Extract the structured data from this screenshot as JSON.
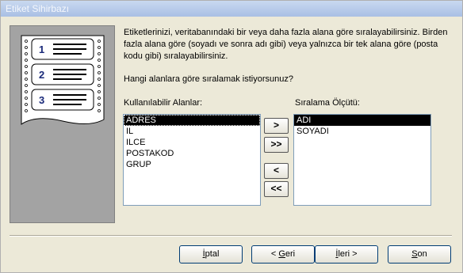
{
  "window": {
    "title": "Etiket Sihirbazı"
  },
  "illustration": {
    "numbers": [
      "1",
      "2",
      "3"
    ]
  },
  "description": "Etiketlerinizi, veritabanındaki bir veya daha fazla alana göre sıralayabilirsiniz. Birden fazla alana göre (soyadı ve sonra adı gibi) veya yalnızca bir tek alana göre (posta kodu gibi) sıralayabilirsiniz.",
  "question": "Hangi alanlara göre sıralamak istiyorsunuz?",
  "available": {
    "label": "Kullanılabilir Alanlar:",
    "items": [
      "ADRES",
      "IL",
      "ILCE",
      "POSTAKOD",
      "GRUP"
    ],
    "selected_index": 0
  },
  "sort": {
    "label": "Sıralama Ölçütü:",
    "items": [
      "ADI",
      "SOYADI"
    ],
    "selected_index": 0
  },
  "move_buttons": {
    "add_one": ">",
    "add_all": ">>",
    "remove_one": "<",
    "remove_all": "<<"
  },
  "footer": {
    "cancel": {
      "before": "",
      "accel": "İ",
      "after": "ptal"
    },
    "back": {
      "before": "< ",
      "accel": "G",
      "after": "eri"
    },
    "next": {
      "before": "",
      "accel": "İ",
      "after": "leri >"
    },
    "finish": {
      "before": "",
      "accel": "S",
      "after": "on"
    }
  }
}
